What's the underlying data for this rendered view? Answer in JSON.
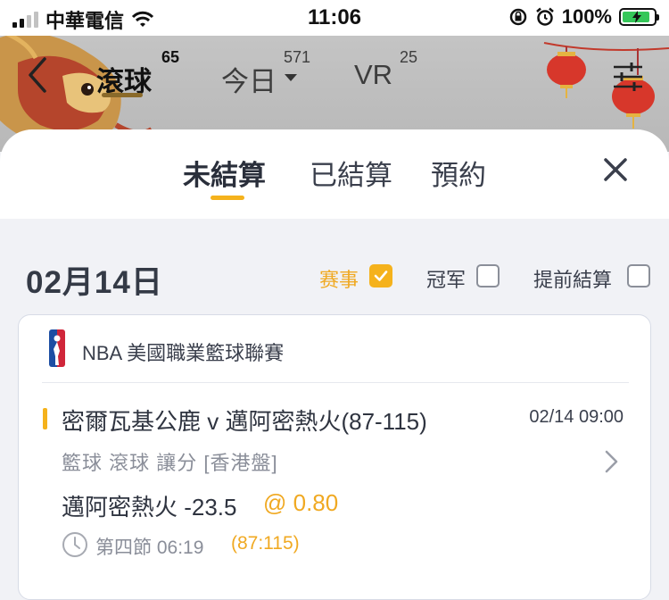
{
  "status_bar": {
    "carrier": "中華電信",
    "time": "11:06",
    "battery": "100%"
  },
  "nav": {
    "tabs": [
      {
        "label": "滾球",
        "count": "65"
      },
      {
        "label": "今日",
        "count": "571"
      },
      {
        "label": "VR",
        "count": "25"
      }
    ]
  },
  "segments": [
    "未結算",
    "已結算",
    "預約"
  ],
  "date_heading": "02月14日",
  "filters": [
    {
      "label": "赛事",
      "checked": true
    },
    {
      "label": "冠军",
      "checked": false
    },
    {
      "label": "提前結算",
      "checked": false
    }
  ],
  "bet_card": {
    "league": "NBA 美國職業籃球聯賽",
    "match": "密爾瓦基公鹿 v 邁阿密熱火(87-115)",
    "time": "02/14 09:00",
    "bet_type": "籃球  滾球   讓分  [香港盤]",
    "selection": "邁阿密熱火 -23.5",
    "odds": "@ 0.80",
    "period": "第四節  06:19",
    "period_score": "(87:115)"
  },
  "colors": {
    "accent": "#f5b21c",
    "text": "#2f3440",
    "muted": "#8a8e99",
    "background": "#f1f2f6"
  },
  "icons": [
    "signal-icon",
    "wifi-icon",
    "lock-rotation-icon",
    "alarm-icon",
    "battery-icon",
    "back-icon",
    "dropdown-caret-icon",
    "filter-sliders-icon",
    "close-icon",
    "checkbox-check-icon",
    "nba-logo-icon",
    "chevron-right-icon",
    "clock-icon"
  ]
}
